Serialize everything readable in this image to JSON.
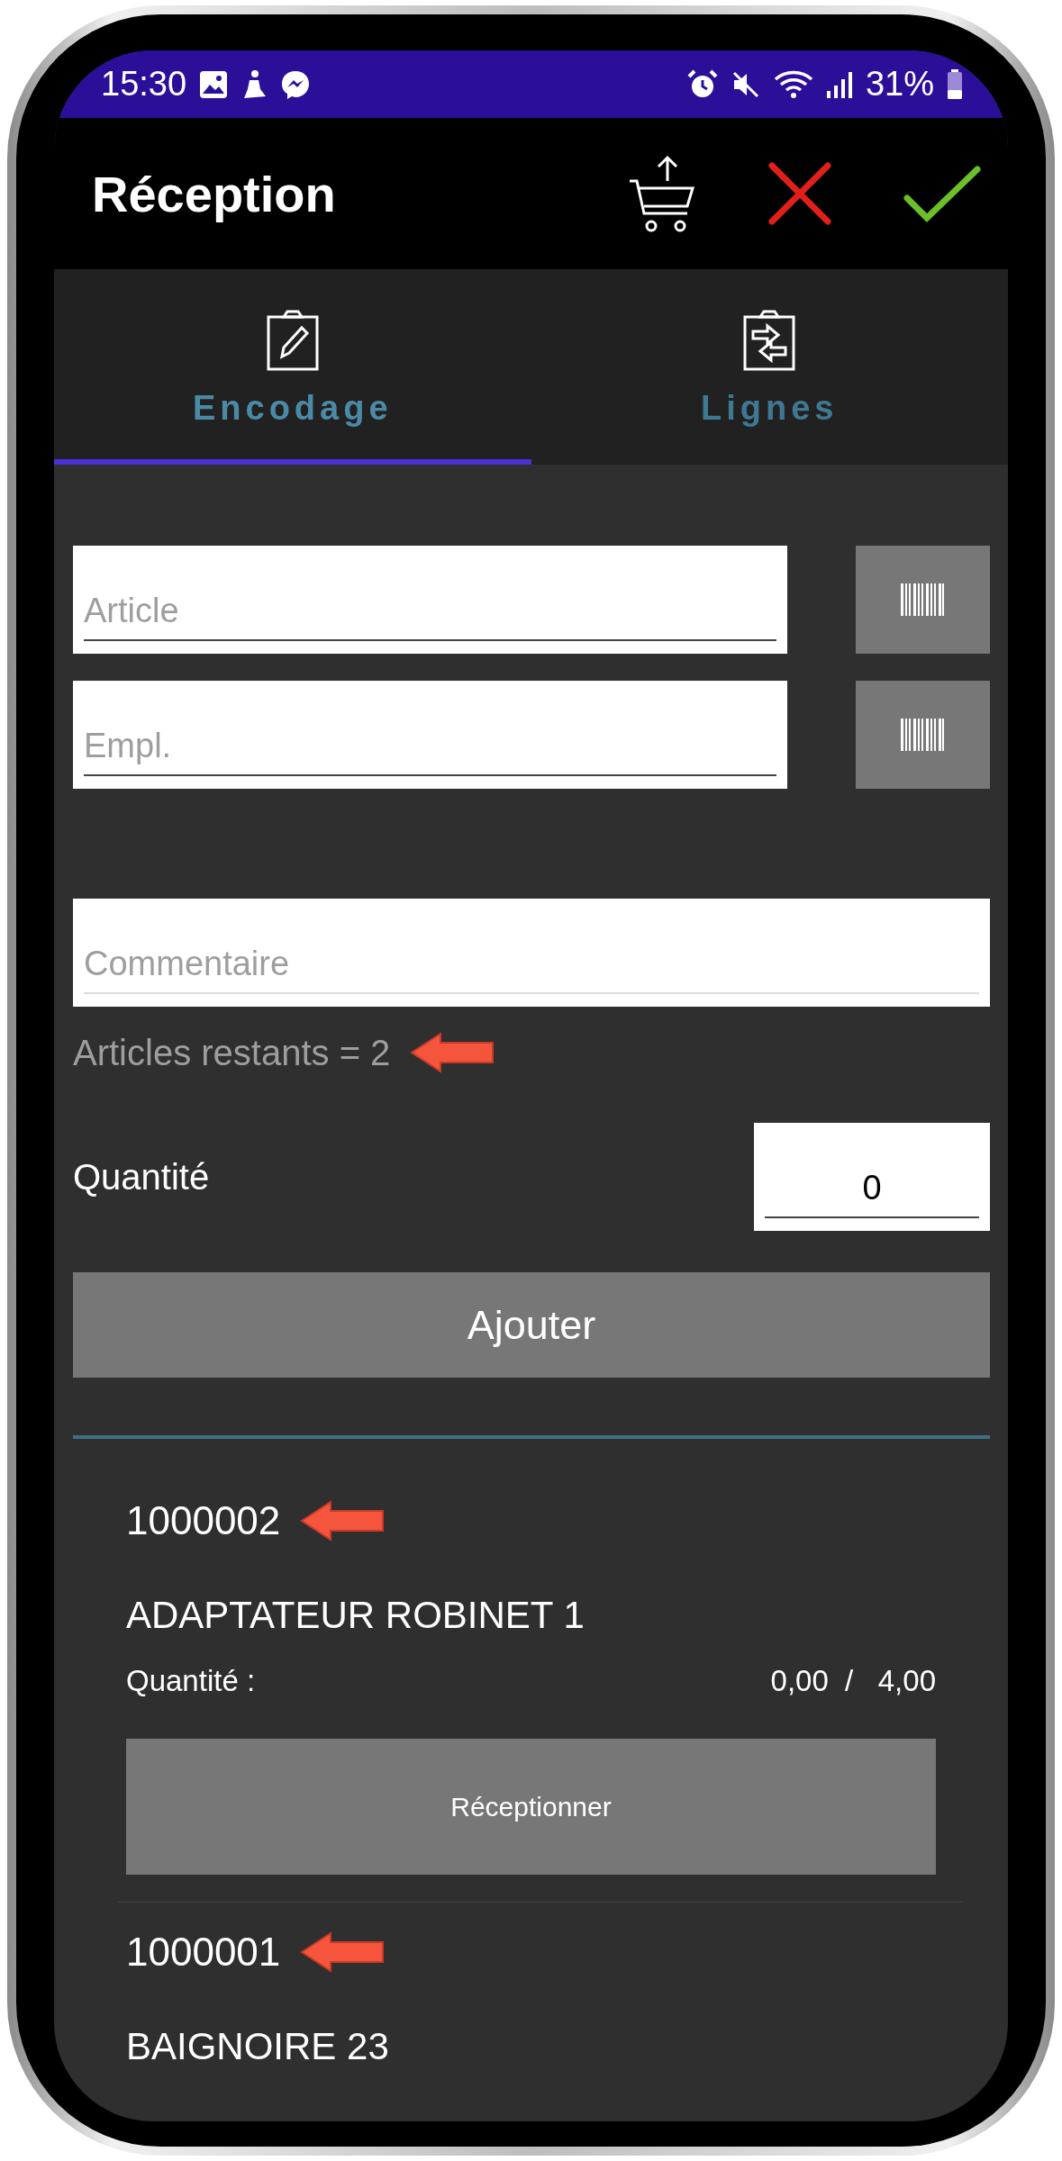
{
  "status_bar": {
    "time": "15:30",
    "battery": "31%"
  },
  "header": {
    "title": "Réception"
  },
  "tabs": [
    {
      "label": "Encodage",
      "kind": "edit",
      "selected": true
    },
    {
      "label": "Lignes",
      "kind": "transfer",
      "selected": false
    }
  ],
  "form": {
    "article": {
      "placeholder": "Article"
    },
    "location": {
      "placeholder": "Empl."
    },
    "comment": {
      "placeholder": "Commentaire"
    },
    "remaining": {
      "text": "Articles restants = 2",
      "marked": true
    },
    "quantity": {
      "label": "Quantité",
      "value": "0"
    },
    "add_button": "Ajouter"
  },
  "lines": [
    {
      "number": "1000002",
      "marked": true,
      "name": "ADAPTATEUR ROBINET 1",
      "quantity_label": "Quantité :",
      "received": "0,00",
      "separator": "/",
      "expected": "4,00",
      "button": "Réceptionner"
    },
    {
      "number": "1000001",
      "marked": true,
      "name": "BAIGNOIRE 23"
    }
  ]
}
